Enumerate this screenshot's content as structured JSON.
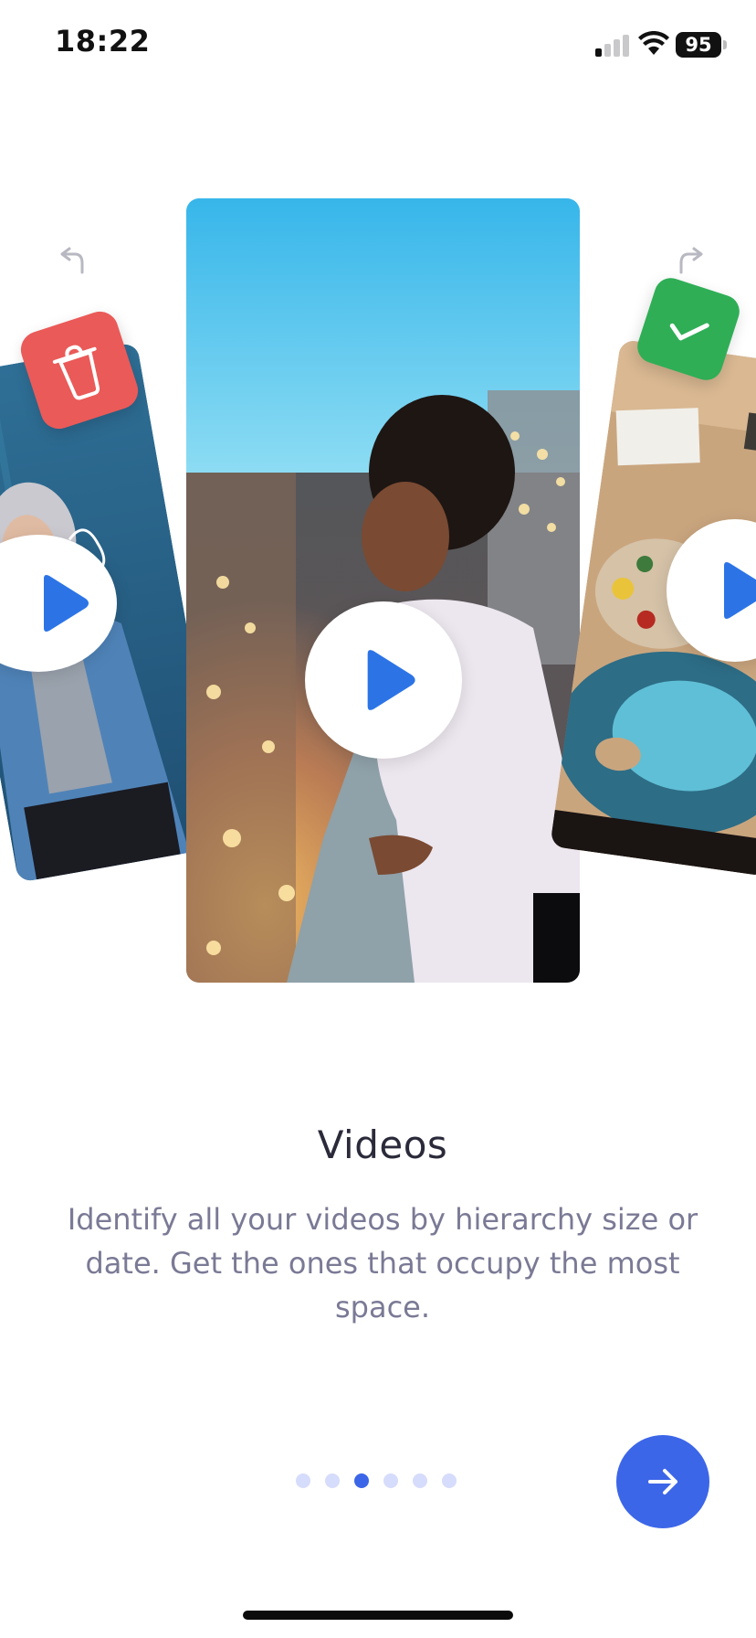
{
  "status_bar": {
    "time": "18:22",
    "battery": "95"
  },
  "carousel": {
    "left_badge_icon": "trash-icon",
    "right_badge_icon": "checkmark-icon",
    "left_arrow_icon": "undo-arrow-icon",
    "right_arrow_icon": "redo-arrow-icon",
    "play_icon": "play-icon"
  },
  "slide": {
    "title": "Videos",
    "description": "Identify all your videos by hierarchy size or date. Get the ones that occupy the most space."
  },
  "pagination": {
    "total_pages": 6,
    "current_page": 3
  },
  "next_button": {
    "icon": "arrow-right-icon"
  },
  "colors": {
    "accent": "#3c66e8",
    "delete_badge": "#ea5a58",
    "keep_badge": "#2fae56",
    "title_text": "#2a2a3a",
    "body_text": "#7a7a96",
    "dot_inactive": "#d6dcfb"
  }
}
